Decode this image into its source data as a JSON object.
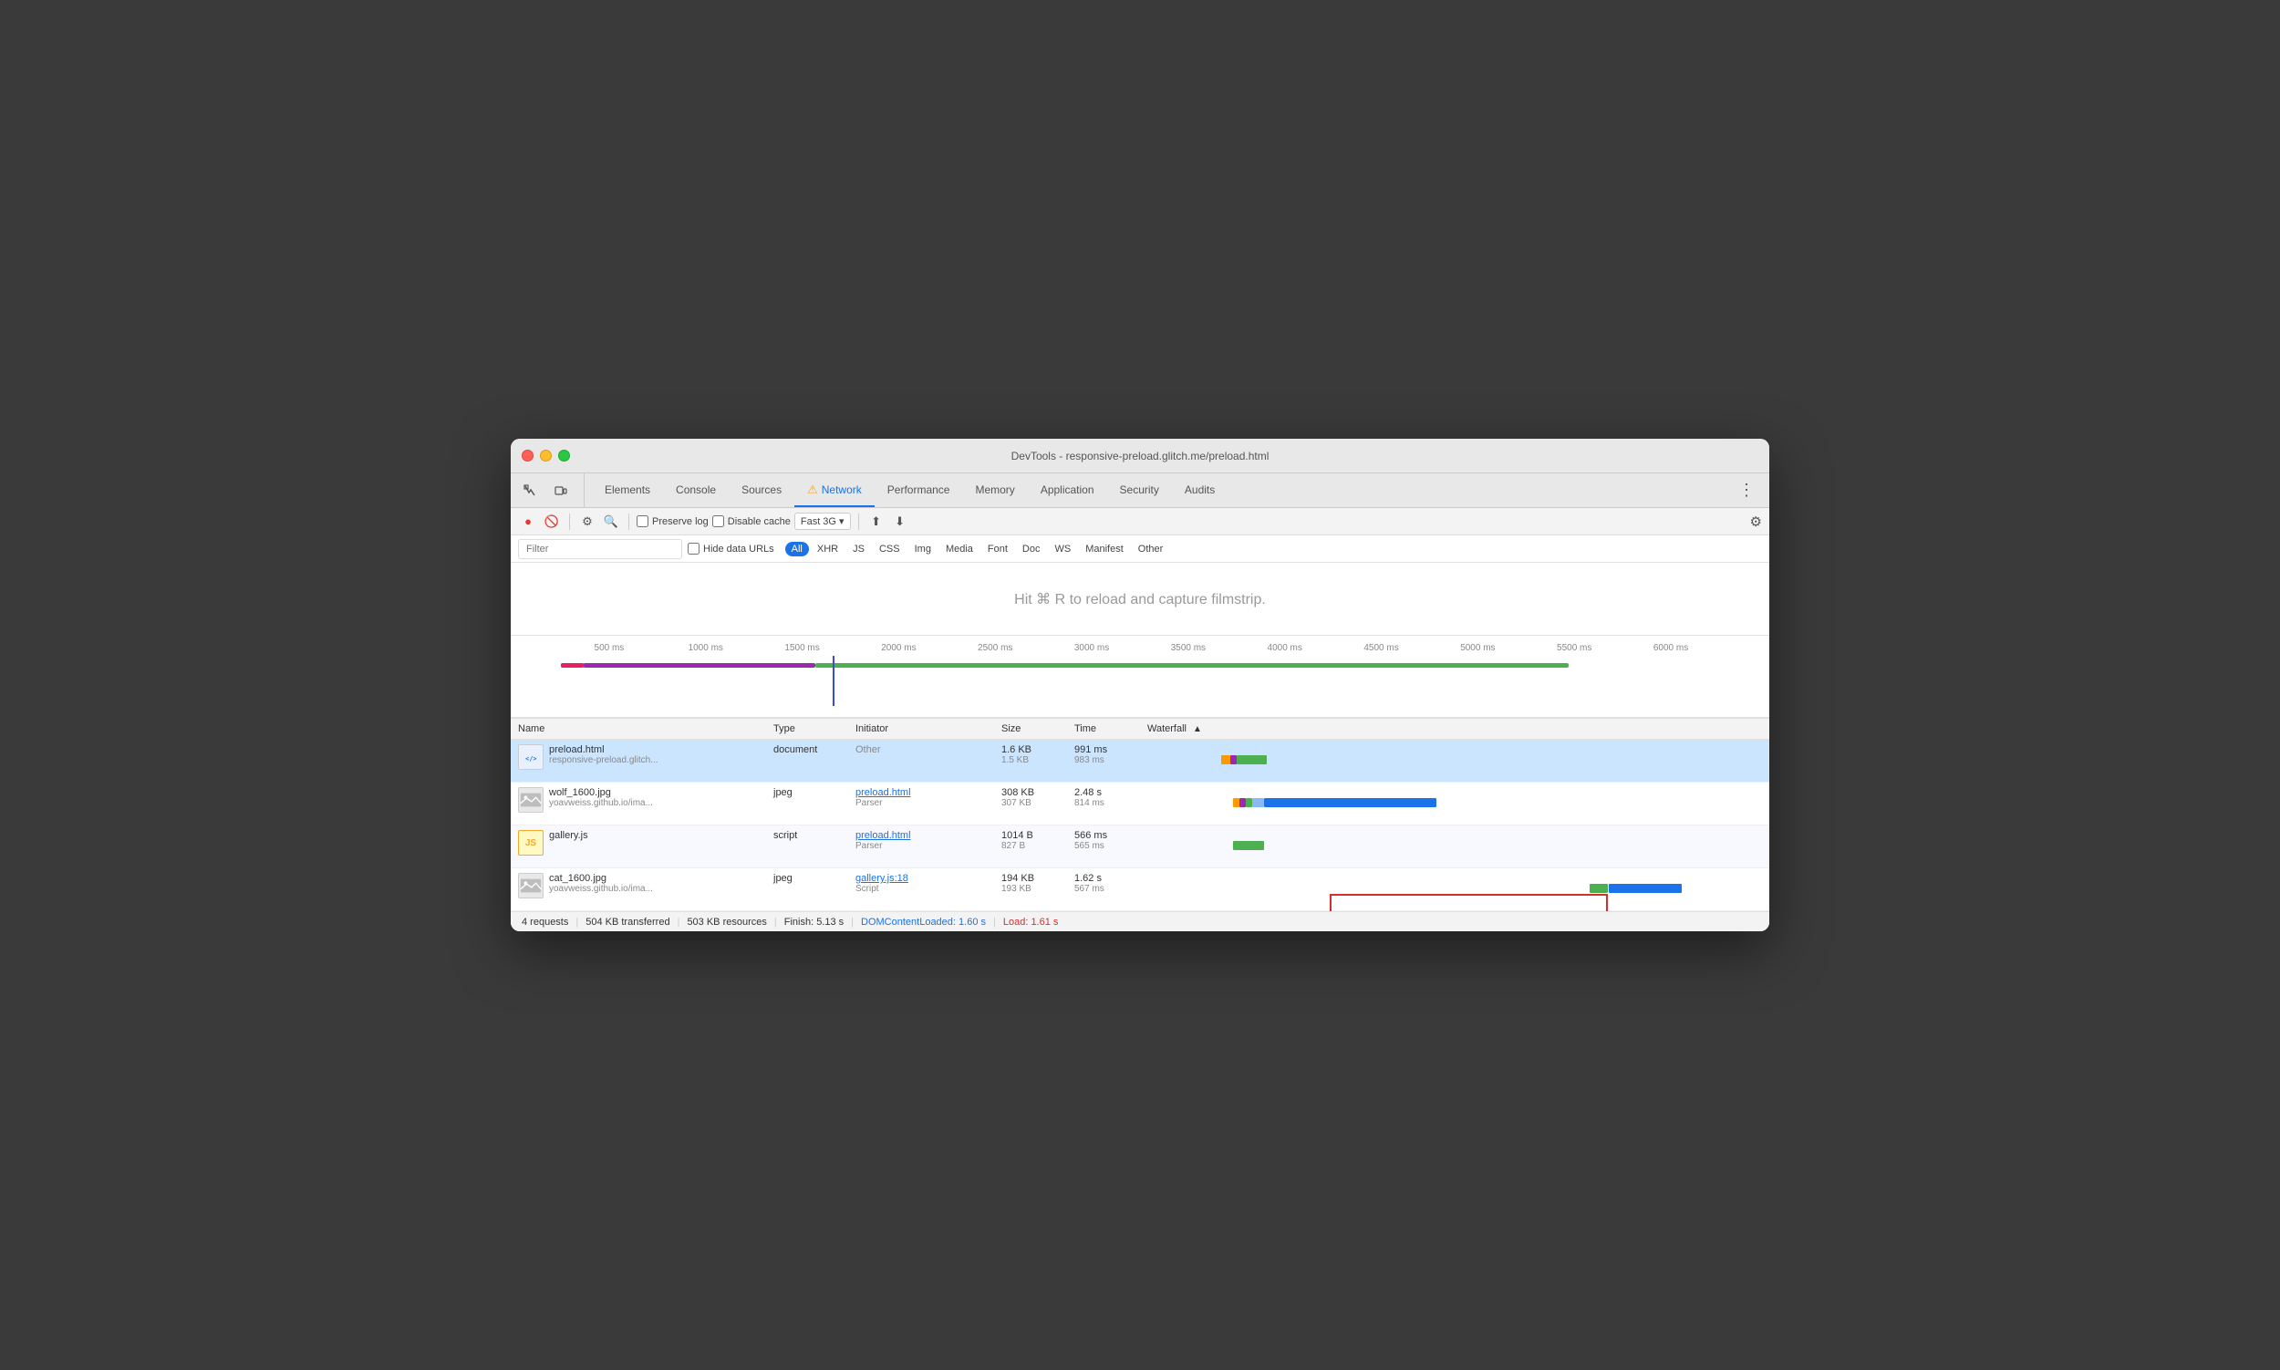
{
  "window": {
    "title": "DevTools - responsive-preload.glitch.me/preload.html"
  },
  "tabs": {
    "items": [
      {
        "label": "Elements",
        "active": false
      },
      {
        "label": "Console",
        "active": false
      },
      {
        "label": "Sources",
        "active": false
      },
      {
        "label": "Network",
        "active": true,
        "warning": true
      },
      {
        "label": "Performance",
        "active": false
      },
      {
        "label": "Memory",
        "active": false
      },
      {
        "label": "Application",
        "active": false
      },
      {
        "label": "Security",
        "active": false
      },
      {
        "label": "Audits",
        "active": false
      }
    ]
  },
  "toolbar": {
    "preserve_log": "Preserve log",
    "disable_cache": "Disable cache",
    "throttle": "Fast 3G"
  },
  "filter": {
    "placeholder": "Filter",
    "hide_data_urls": "Hide data URLs",
    "types": [
      "All",
      "XHR",
      "JS",
      "CSS",
      "Img",
      "Media",
      "Font",
      "Doc",
      "WS",
      "Manifest",
      "Other"
    ]
  },
  "filmstrip": {
    "hint": "Hit ⌘ R to reload and capture filmstrip."
  },
  "timeline": {
    "ticks": [
      "500 ms",
      "1000 ms",
      "1500 ms",
      "2000 ms",
      "2500 ms",
      "3000 ms",
      "3500 ms",
      "4000 ms",
      "4500 ms",
      "5000 ms",
      "5500 ms",
      "6000 ms"
    ]
  },
  "table": {
    "columns": [
      "Name",
      "Type",
      "Initiator",
      "Size",
      "Time",
      "Waterfall"
    ],
    "rows": [
      {
        "icon_type": "html",
        "filename": "preload.html",
        "url": "responsive-preload.glitch...",
        "type": "document",
        "initiator": "Other",
        "initiator_link": false,
        "size_transferred": "1.6 KB",
        "size_actual": "1.5 KB",
        "time_main": "991 ms",
        "time_sub": "983 ms",
        "selected": true
      },
      {
        "icon_type": "img",
        "filename": "wolf_1600.jpg",
        "url": "yoavweiss.github.io/ima...",
        "type": "jpeg",
        "initiator": "preload.html",
        "initiator_link": true,
        "initiator_sub": "Parser",
        "size_transferred": "308 KB",
        "size_actual": "307 KB",
        "time_main": "2.48 s",
        "time_sub": "814 ms",
        "selected": false
      },
      {
        "icon_type": "js",
        "filename": "gallery.js",
        "url": "",
        "type": "script",
        "initiator": "preload.html",
        "initiator_link": true,
        "initiator_sub": "Parser",
        "size_transferred": "1014 B",
        "size_actual": "827 B",
        "time_main": "566 ms",
        "time_sub": "565 ms",
        "selected": false
      },
      {
        "icon_type": "img",
        "filename": "cat_1600.jpg",
        "url": "yoavweiss.github.io/ima...",
        "type": "jpeg",
        "initiator": "gallery.js:18",
        "initiator_link": true,
        "initiator_sub": "Script",
        "size_transferred": "194 KB",
        "size_actual": "193 KB",
        "time_main": "1.62 s",
        "time_sub": "567 ms",
        "selected": false
      }
    ]
  },
  "status": {
    "requests": "4 requests",
    "transferred": "504 KB transferred",
    "resources": "503 KB resources",
    "finish": "Finish: 5.13 s",
    "dom_content": "DOMContentLoaded: 1.60 s",
    "load": "Load: 1.61 s"
  }
}
